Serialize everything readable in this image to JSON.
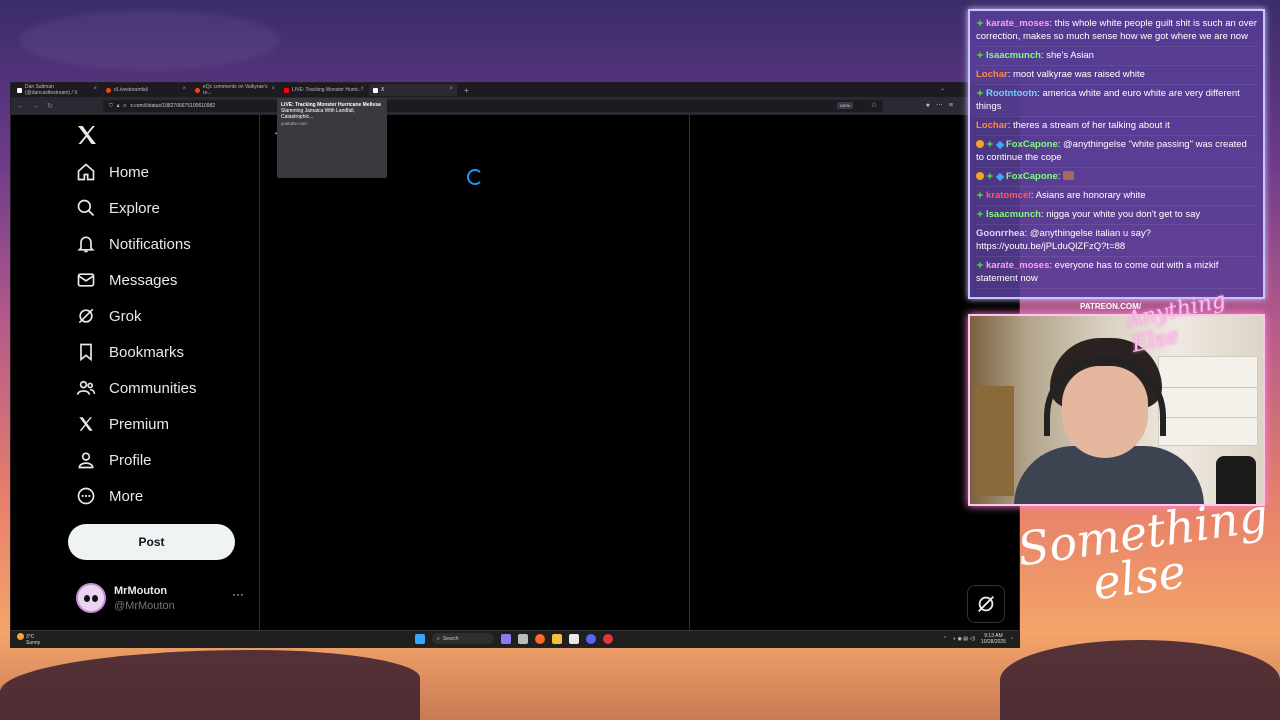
{
  "browser": {
    "tabs": [
      {
        "label": "Dan Saltman (@dancastlestream) / X",
        "fav_color": "#ffffff",
        "active": false
      },
      {
        "label": "r/Livestreamfail",
        "fav_color": "#ff4500",
        "active": false
      },
      {
        "label": "eQc comments on Valkyrae's re...",
        "fav_color": "#ff4500",
        "active": false
      },
      {
        "label": "LIVE: Tracking Monster Hurric...",
        "fav_color": "#ff0000",
        "active": false
      },
      {
        "label": "X",
        "fav_color": "#ffffff",
        "active": true
      }
    ],
    "new_tab": "+",
    "url": "x.com/i/status/1982766675100610982",
    "zoom": "160%",
    "tooltip": {
      "title": "LIVE: Tracking Monster Hurricane Melissa",
      "line": "Slamming Jamaica With Landfall, Catastrophic...",
      "domain": "youtube.com"
    }
  },
  "x": {
    "nav": [
      {
        "label": "Home",
        "icon": "home-icon"
      },
      {
        "label": "Explore",
        "icon": "search-icon"
      },
      {
        "label": "Notifications",
        "icon": "bell-icon"
      },
      {
        "label": "Messages",
        "icon": "mail-icon"
      },
      {
        "label": "Grok",
        "icon": "grok-icon"
      },
      {
        "label": "Bookmarks",
        "icon": "bookmark-icon"
      },
      {
        "label": "Communities",
        "icon": "people-icon"
      },
      {
        "label": "Premium",
        "icon": "x-icon"
      },
      {
        "label": "Profile",
        "icon": "person-icon"
      },
      {
        "label": "More",
        "icon": "more-circle-icon"
      }
    ],
    "post_button": "Post",
    "account": {
      "name": "MrMouton",
      "handle": "@MrMouton",
      "more": "···"
    }
  },
  "taskbar": {
    "weather_temp": "3°C",
    "weather_desc": "Sunny",
    "search": "Search",
    "time": "9:13 AM",
    "date": "10/28/2025"
  },
  "chat": {
    "messages": [
      {
        "badges": [
          "green"
        ],
        "user": "karate_moses",
        "color": "#ff9ff3",
        "text": "this whole white people guilt shit is such an over correction, makes so much sense how we got where we are now"
      },
      {
        "badges": [
          "green"
        ],
        "user": "Isaacmunch",
        "color": "#7dff7a",
        "text": "she's Asian"
      },
      {
        "badges": [],
        "user": "Lochar",
        "color": "#ff8a3d",
        "text": "moot valkyrae was raised white"
      },
      {
        "badges": [
          "green"
        ],
        "user": "Rootntootn",
        "color": "#6fd3ff",
        "text": "america white and euro white are very different things"
      },
      {
        "badges": [],
        "user": "Lochar",
        "color": "#ff8a3d",
        "text": "theres a stream of her talking about it"
      },
      {
        "badges": [
          "orange",
          "green",
          "blue"
        ],
        "user": "FoxCapone",
        "color": "#7dff7a",
        "text": "@anythingelse \"white passing\" was created to continue the cope"
      },
      {
        "badges": [
          "orange",
          "green",
          "blue"
        ],
        "user": "FoxCapone",
        "color": "#7dff7a",
        "text": "",
        "emote": true
      },
      {
        "badges": [
          "green"
        ],
        "user": "kratomcel",
        "color": "#ff5a5a",
        "text": "Asians are honorary white"
      },
      {
        "badges": [
          "green"
        ],
        "user": "Isaacmunch",
        "color": "#7dff7a",
        "text": "nigga your white you don't get to say"
      },
      {
        "badges": [],
        "user": "Goonrrhea",
        "color": "#d9d4ff",
        "text": "@anythingelse italian u say? https://youtu.be/jPLduQlZFzQ?t=88"
      },
      {
        "badges": [
          "green"
        ],
        "user": "karate_moses",
        "color": "#ff9ff3",
        "text": "everyone has to come out with a mizkif statement now"
      }
    ]
  },
  "overlay": {
    "patreon": "PATREON.COM/",
    "cam_logo": "Anything Else",
    "script_line1": "Something",
    "script_line2": "else"
  }
}
